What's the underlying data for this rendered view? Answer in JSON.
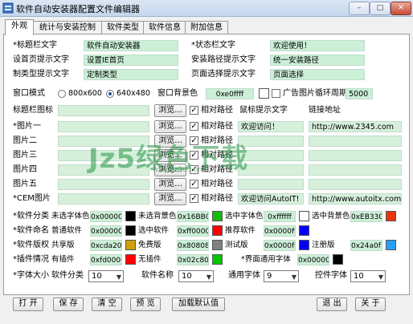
{
  "window": {
    "title": "软件自动安装器配置文件编辑器",
    "btn_min": "–",
    "btn_max": "□",
    "btn_close": "✕"
  },
  "tabs": [
    "外观",
    "统计与安装控制",
    "软件类型",
    "软件信息",
    "附加信息"
  ],
  "appearance": {
    "title_label": "*标题栏文字",
    "title_value": "软件自动安装器",
    "status_label": "*状态栏文字",
    "status_value": "欢迎使用！",
    "home_label": "设首页提示文字",
    "home_value": "设置IE首页",
    "path_label": "安装路径提示文字",
    "path_value": "统一安装路径",
    "custom_label": "制类型提示文字",
    "custom_value": "定制类型",
    "page_label": "页面选择提示文字",
    "page_value": "页面选择",
    "window_mode_label": "窗口模式",
    "mode_800": "800x600",
    "mode_640": "640x480",
    "bg_label": "窗口背景色",
    "bg_value": "0xe0ffff",
    "ad_label": "广告图片循环周期",
    "ad_value": "5000"
  },
  "images": {
    "icon_label": "标题栏图标",
    "rows": [
      {
        "label": "*图片一",
        "value": ""
      },
      {
        "label": "图片二",
        "value": ""
      },
      {
        "label": "图片三",
        "value": ""
      },
      {
        "label": "图片四",
        "value": ""
      },
      {
        "label": "图片五",
        "value": ""
      },
      {
        "label": "*CEM图片",
        "value": ""
      }
    ],
    "browse": "浏览...",
    "relative": "相对路径",
    "hover_label": "鼠标提示文字",
    "addr_label": "链接地址",
    "hover1": "欢迎访问！",
    "addr1": "http://www.2345.com",
    "hover6": "欢迎访问AutoIT!",
    "addr6": "http://www.autoitx.com"
  },
  "colors": {
    "rows": [
      {
        "label": "*软件分类",
        "items": [
          {
            "label": "未选字体色",
            "value": "0x000000",
            "color": "#000000"
          },
          {
            "label": "未选背景色",
            "value": "0x16BB09",
            "color": "#16BB09"
          },
          {
            "label": "选中字体色",
            "value": "0xffffff",
            "color": "#ffffff"
          },
          {
            "label": "选中背景色",
            "value": "0xEB330C",
            "color": "#EB330C"
          }
        ]
      },
      {
        "label": "*软件命名",
        "items": [
          {
            "label": "普通软件",
            "value": "0x000000",
            "color": "#000000"
          },
          {
            "label": "选中软件",
            "value": "0xff0000",
            "color": "#ff0000"
          },
          {
            "label": "推荐软件",
            "value": "0x0000ff",
            "color": "#0000ff"
          }
        ]
      },
      {
        "label": "*软件版权",
        "items": [
          {
            "label": "共享版",
            "value": "0xcda20c",
            "color": "#cda20c"
          },
          {
            "label": "免费版",
            "value": "0x808080",
            "color": "#808080"
          },
          {
            "label": "测试版",
            "value": "0x0000f6",
            "color": "#0000f6"
          },
          {
            "label": "注册版",
            "value": "0x24a0f7",
            "color": "#24a0f7"
          }
        ]
      },
      {
        "label": "*插件情况",
        "items": [
          {
            "label": "有插件",
            "value": "0xfd0000",
            "color": "#fd0000"
          },
          {
            "label": "无插件",
            "value": "0x02c800",
            "color": "#02c800"
          },
          {
            "label": "*界面通用字体",
            "value": "0x000000",
            "color": "#000000"
          }
        ]
      }
    ]
  },
  "fonts": {
    "label": "*字体大小",
    "items": [
      {
        "label": "软件分类",
        "value": "10"
      },
      {
        "label": "软件名称",
        "value": "10"
      },
      {
        "label": "通用字体",
        "value": "9"
      },
      {
        "label": "控件字体",
        "value": "10"
      }
    ]
  },
  "buttons": {
    "open": "打 开",
    "save": "保 存",
    "clear": "清 空",
    "preview": "预 览",
    "load_default": "加载默认值",
    "exit": "退 出",
    "about": "关 于"
  },
  "watermark": {
    "main": "Jz5绿色下载",
    "sub": "www.jz5u.com"
  }
}
